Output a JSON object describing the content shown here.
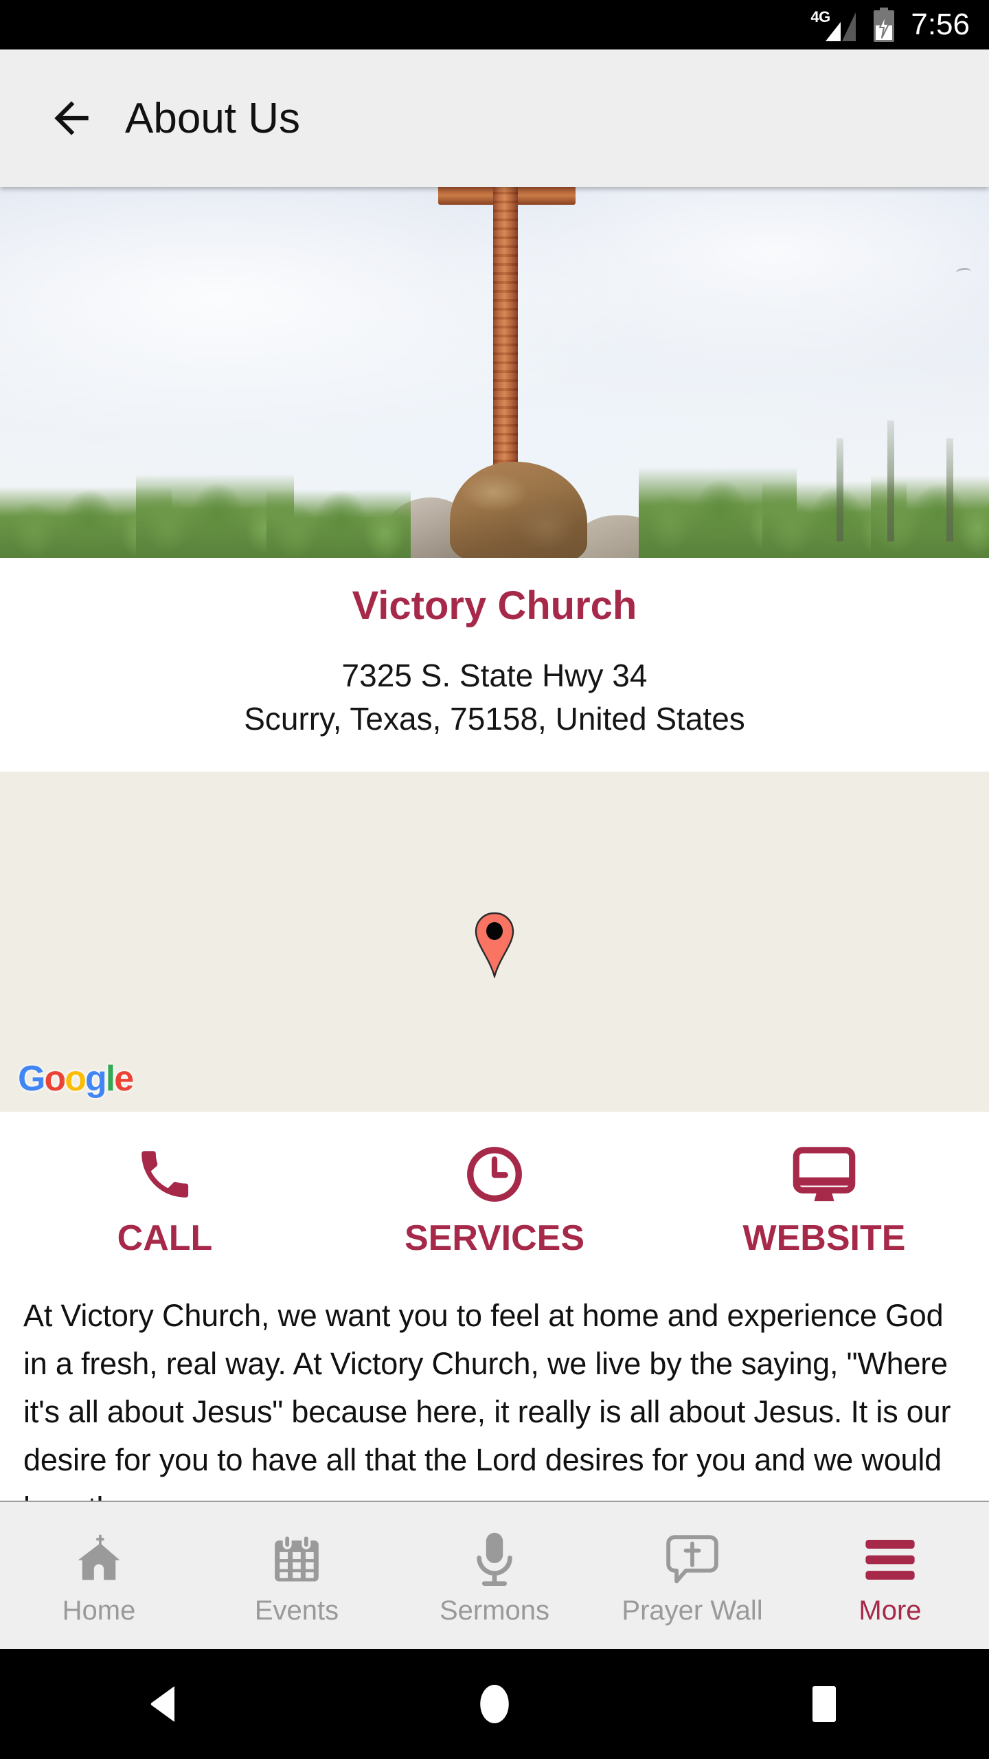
{
  "status_bar": {
    "network_label": "4G",
    "network_icon": "signal-bars-icon",
    "battery_icon": "battery-charging-icon",
    "time": "7:56"
  },
  "app_bar": {
    "back_icon": "back-arrow-icon",
    "title": "About Us"
  },
  "hero": {
    "alt": "wooden-cross-on-rock-photo"
  },
  "venue": {
    "name": "Victory Church",
    "address_line1": "7325 S. State Hwy 34",
    "address_line2": "Scurry, Texas, 75158, United States"
  },
  "map": {
    "pin_icon": "map-pin-icon",
    "attribution": "Google",
    "attribution_letters": [
      "G",
      "o",
      "o",
      "g",
      "l",
      "e"
    ],
    "background_color": "#F0EDE5",
    "pin_color": "#F97463"
  },
  "actions": [
    {
      "label": "CALL",
      "icon": "phone-icon"
    },
    {
      "label": "SERVICES",
      "icon": "clock-icon"
    },
    {
      "label": "WEBSITE",
      "icon": "monitor-icon"
    }
  ],
  "about": {
    "body": "At Victory Church, we want you to feel at home and experience God in a fresh, real way.  At Victory Church, we live by the saying, \"Where it's all about Jesus\" because here, it really is all about Jesus.  It is our desire for you to have all that the Lord desires for you and we would love the"
  },
  "tabs": [
    {
      "label": "Home",
      "icon": "church-icon",
      "active": false
    },
    {
      "label": "Events",
      "icon": "calendar-icon",
      "active": false
    },
    {
      "label": "Sermons",
      "icon": "microphone-icon",
      "active": false
    },
    {
      "label": "Prayer Wall",
      "icon": "cross-bubble-icon",
      "active": false
    },
    {
      "label": "More",
      "icon": "hamburger-menu-icon",
      "active": true
    }
  ],
  "nav_bar": {
    "back": "android-back-icon",
    "home": "android-home-icon",
    "recents": "android-recents-icon"
  },
  "colors": {
    "accent": "#A6294A",
    "app_bar_bg": "#EEEEEE",
    "tab_bar_bg": "#EFEFEF",
    "tab_inactive": "#9A9A9A",
    "map_bg": "#F0EDE5"
  }
}
